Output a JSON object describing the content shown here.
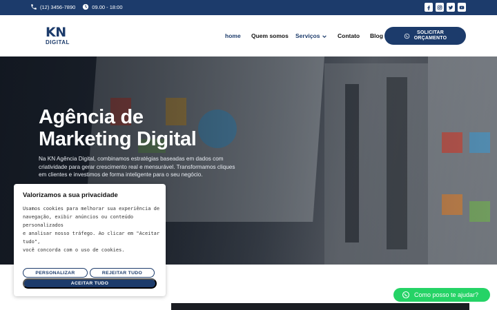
{
  "topbar": {
    "phone": "(12) 3456-7890",
    "hours": "09.00 - 18:00",
    "socials": [
      "facebook-icon",
      "instagram-icon",
      "twitter-icon",
      "youtube-icon"
    ]
  },
  "header": {
    "logo_main": "KN",
    "logo_sub": "DIGITAL",
    "nav": [
      {
        "label": "home",
        "active": true
      },
      {
        "label": "Quem somos"
      },
      {
        "label": "Serviços",
        "has_dropdown": true
      },
      {
        "label": "Contato"
      },
      {
        "label": "Blog"
      }
    ],
    "cta_line1": "SOLICITAR",
    "cta_line2": "ORÇAMENTO"
  },
  "hero": {
    "title_line1": "Agência de",
    "title_line2": "Marketing Digital",
    "text": "Na KN Agência Digital, combinamos estratégias baseadas em dados com criatividade para gerar crescimento real e mensurável. Transformamos cliques em clientes e investimos de forma inteligente para o seu negócio."
  },
  "cookie": {
    "title": "Valorizamos a sua privacidade",
    "message": "Usamos cookies para melhorar sua experiência de\nnavegação, exibir anúncios ou conteúdo personalizados\ne analisar nosso tráfego. Ao clicar em \"Aceitar tudo\",\nvocê concorda com o uso de cookies.",
    "btn_customize": "PERSONALIZAR",
    "btn_reject": "REJEITAR TUDO",
    "btn_accept": "ACEITAR TUDO"
  },
  "whatsapp_chat": {
    "label": "Como posso te ajudar?"
  },
  "colors": {
    "brand": "#1c3b6b",
    "whatsapp": "#25d366"
  }
}
